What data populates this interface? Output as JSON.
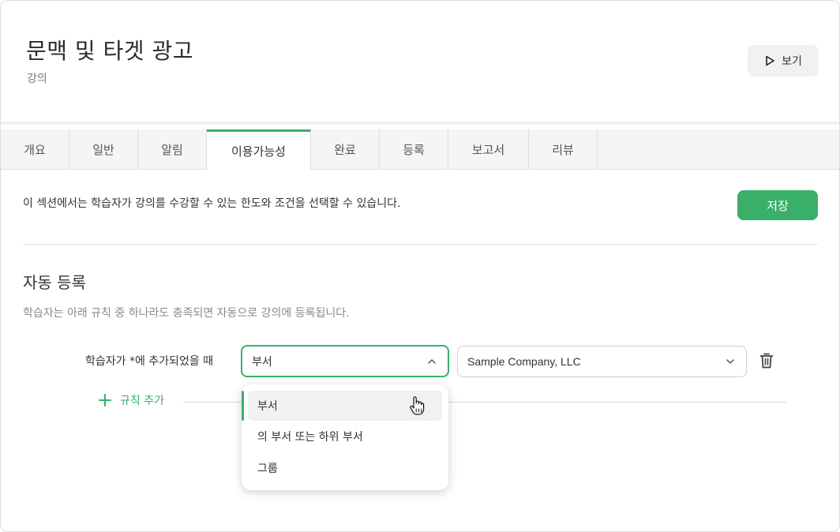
{
  "header": {
    "title": "문맥 및 타겟 광고",
    "subtitle": "강의",
    "view_button": "보기"
  },
  "tabs": [
    {
      "label": "개요",
      "active": false
    },
    {
      "label": "일반",
      "active": false
    },
    {
      "label": "알림",
      "active": false
    },
    {
      "label": "이용가능성",
      "active": true
    },
    {
      "label": "완료",
      "active": false
    },
    {
      "label": "등록",
      "active": false
    },
    {
      "label": "보고서",
      "active": false
    },
    {
      "label": "리뷰",
      "active": false
    }
  ],
  "intro_text": "이 섹션에서는 학습자가 강의를 수강할 수 있는 한도와 조건을 선택할 수 있습니다.",
  "save_button": "저장",
  "auto_enroll": {
    "title": "자동 등록",
    "description": "학습자는 아래 규칙 중 하나라도 충족되면 자동으로 강의에 등록됩니다.",
    "rule_label": "학습자가 *에 추가되었을 때",
    "selected_type": "부서",
    "selected_company": "Sample Company, LLC",
    "add_rule": "규칙 추가",
    "menu_options": [
      "부서",
      "의 부서 또는 하위 부서",
      "그룹"
    ]
  },
  "colors": {
    "accent": "#3aaf6a"
  }
}
